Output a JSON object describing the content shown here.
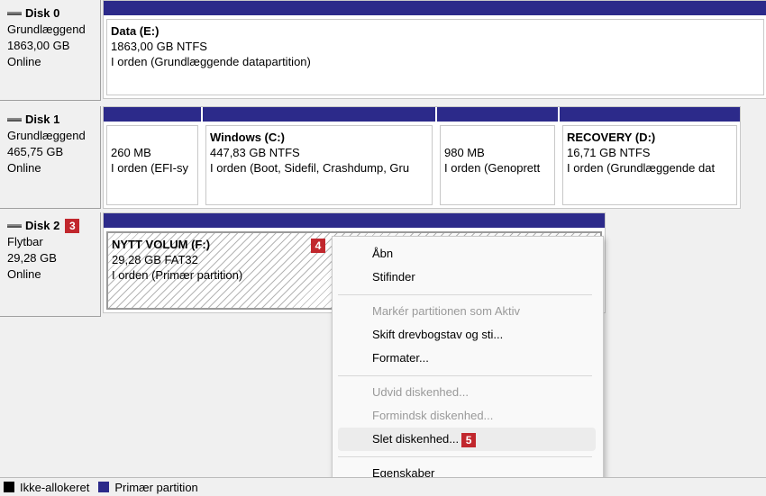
{
  "disks": [
    {
      "name": "Disk 0",
      "type": "Grundlæggend",
      "size": "1863,00 GB",
      "status": "Online",
      "partitions": [
        {
          "volume": "Data  (E:)",
          "size_fs": "1863,00 GB NTFS",
          "status": "I orden (Grundlæggende datapartition)"
        }
      ]
    },
    {
      "name": "Disk 1",
      "type": "Grundlæggend",
      "size": "465,75 GB",
      "status": "Online",
      "partitions": [
        {
          "volume": "",
          "size_fs": "260 MB",
          "status": "I orden (EFI-sy"
        },
        {
          "volume": "Windows  (C:)",
          "size_fs": "447,83 GB NTFS",
          "status": "I orden (Boot, Sidefil, Crashdump, Gru"
        },
        {
          "volume": "",
          "size_fs": "980 MB",
          "status": "I orden (Genoprett"
        },
        {
          "volume": "RECOVERY  (D:)",
          "size_fs": "16,71 GB NTFS",
          "status": "I orden (Grundlæggende dat"
        }
      ]
    },
    {
      "name": "Disk 2",
      "badge": "3",
      "type": "Flytbar",
      "size": "29,28 GB",
      "status": "Online",
      "partitions": [
        {
          "volume": "NYTT VOLUM  (F:)",
          "size_fs": "29,28 GB FAT32",
          "status": "I orden (Primær partition)",
          "badge": "4"
        }
      ]
    }
  ],
  "context_menu": {
    "items": [
      {
        "label": "Åbn",
        "enabled": true
      },
      {
        "label": "Stifinder",
        "enabled": true
      },
      {
        "label": "Markér partitionen som Aktiv",
        "enabled": false
      },
      {
        "label": "Skift drevbogstav og sti...",
        "enabled": true
      },
      {
        "label": "Formater...",
        "enabled": true
      },
      {
        "label": "Udvid diskenhed...",
        "enabled": false
      },
      {
        "label": "Formindsk diskenhed...",
        "enabled": false
      },
      {
        "label": "Slet diskenhed...",
        "enabled": true,
        "badge": "5"
      },
      {
        "label": "Egenskaber",
        "enabled": true
      }
    ]
  },
  "legend": {
    "unallocated": "Ikke-allokeret",
    "primary": "Primær partition"
  },
  "colors": {
    "primary_bar": "#2c2a8a",
    "unallocated": "#000000",
    "badge": "#c1272d"
  }
}
